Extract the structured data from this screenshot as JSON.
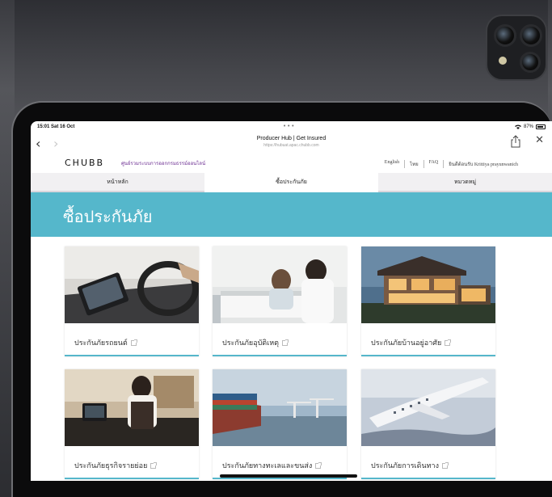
{
  "status_bar": {
    "time": "15:01  Sat 16 Oct",
    "dots": "•••",
    "battery": "87%"
  },
  "browser": {
    "page_title": "Producer Hub | Get Insured",
    "url": "https://hubuat.apac.chubb.com"
  },
  "header": {
    "logo": "CHUBB",
    "tagline": "ศูนย์รวมระบบการออกกรมธรรม์ออนไลน์",
    "links": [
      "English",
      "ไทย",
      "FAQ",
      "ยินดีต้อนรับ Krittiya prayunwanich"
    ]
  },
  "nav": {
    "tabs": [
      {
        "label": "หน้าหลัก"
      },
      {
        "label": "ซื้อประกันภัย"
      },
      {
        "label": "หมวดหมู่"
      }
    ],
    "active_index": 1
  },
  "hero": {
    "title": "ซื้อประกันภัย",
    "color": "#55b7cb"
  },
  "products": [
    {
      "label": "ประกันภัยรถยนต์",
      "image_icon": "car-interior-image"
    },
    {
      "label": "ประกันภัยอุบัติเหตุ",
      "image_icon": "hospital-image"
    },
    {
      "label": "ประกันภัยบ้านอยู่อาศัย",
      "image_icon": "house-image"
    },
    {
      "label": "ประกันภัยธุรกิจรายย่อย",
      "image_icon": "shop-image"
    },
    {
      "label": "ประกันภัยทางทะเลและขนส่ง",
      "image_icon": "cargo-ship-image"
    },
    {
      "label": "ประกันภัยการเดินทาง",
      "image_icon": "airplane-image"
    }
  ]
}
